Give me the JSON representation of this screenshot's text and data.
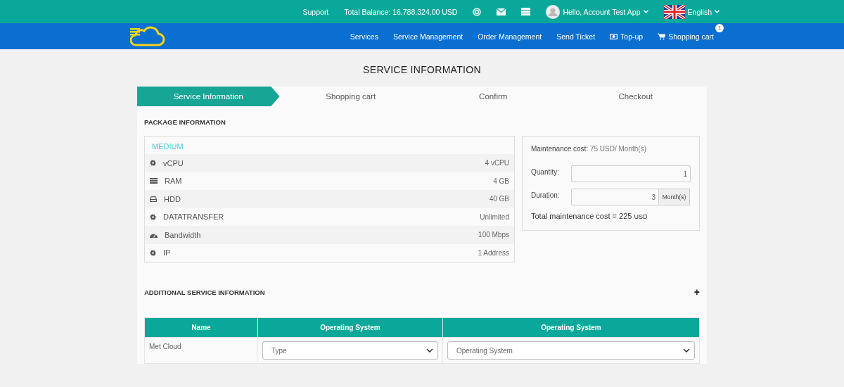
{
  "topbar": {
    "support": "Support",
    "balance": "Total Balance: 16.788.324,00 USD",
    "user": "Hello, Account Test App",
    "language": "English"
  },
  "nav": [
    {
      "label": "Services",
      "kind": "plain"
    },
    {
      "label": "Service Management",
      "kind": "plain"
    },
    {
      "label": "Order Management",
      "kind": "plain"
    },
    {
      "label": "Send Ticket",
      "kind": "plain"
    },
    {
      "label": "Top-up",
      "kind": "money"
    },
    {
      "label": "Shopping cart",
      "kind": "cart",
      "badge": "1"
    }
  ],
  "page_title": "SERVICE INFORMATION",
  "steps": [
    {
      "label": "Service Information",
      "selected": true
    },
    {
      "label": "Shopping cart",
      "selected": false
    },
    {
      "label": "Confirm",
      "selected": false
    },
    {
      "label": "Checkout",
      "selected": false
    }
  ],
  "package": {
    "heading": "PACKAGE INFORMATION",
    "name": "MEDIUM",
    "specs": [
      {
        "kind": "gear",
        "label": "vCPU",
        "value": "4 vCPU"
      },
      {
        "kind": "ram",
        "label": "RAM",
        "value": "4 GB"
      },
      {
        "kind": "hdd",
        "label": "HDD",
        "value": "40 GB"
      },
      {
        "kind": "gear",
        "label": "DATATRANSFER",
        "value": "Unlimited"
      },
      {
        "kind": "gauge",
        "label": "Bandwidth",
        "value": "100 Mbps"
      },
      {
        "kind": "gear",
        "label": "IP",
        "value": "1 Address"
      }
    ]
  },
  "cost": {
    "maintenance_label": "Maintenance cost:",
    "maintenance_value": "75 USD/ Month(s)",
    "quantity_label": "Quantity:",
    "quantity": "1",
    "duration_label": "Duration:",
    "duration": "3",
    "duration_unit": "Month(s)",
    "total_label": "Total maintenance cost = 225",
    "total_unit": "USD"
  },
  "additional": {
    "heading": "ADDITIONAL SERVICE INFORMATION",
    "toggle": "+"
  },
  "table": {
    "columns": [
      "Name",
      "Operating System",
      "Operating System"
    ],
    "rows": [
      {
        "name": "Met Cloud",
        "selects": [
          "Type",
          "Operating System"
        ]
      }
    ]
  }
}
